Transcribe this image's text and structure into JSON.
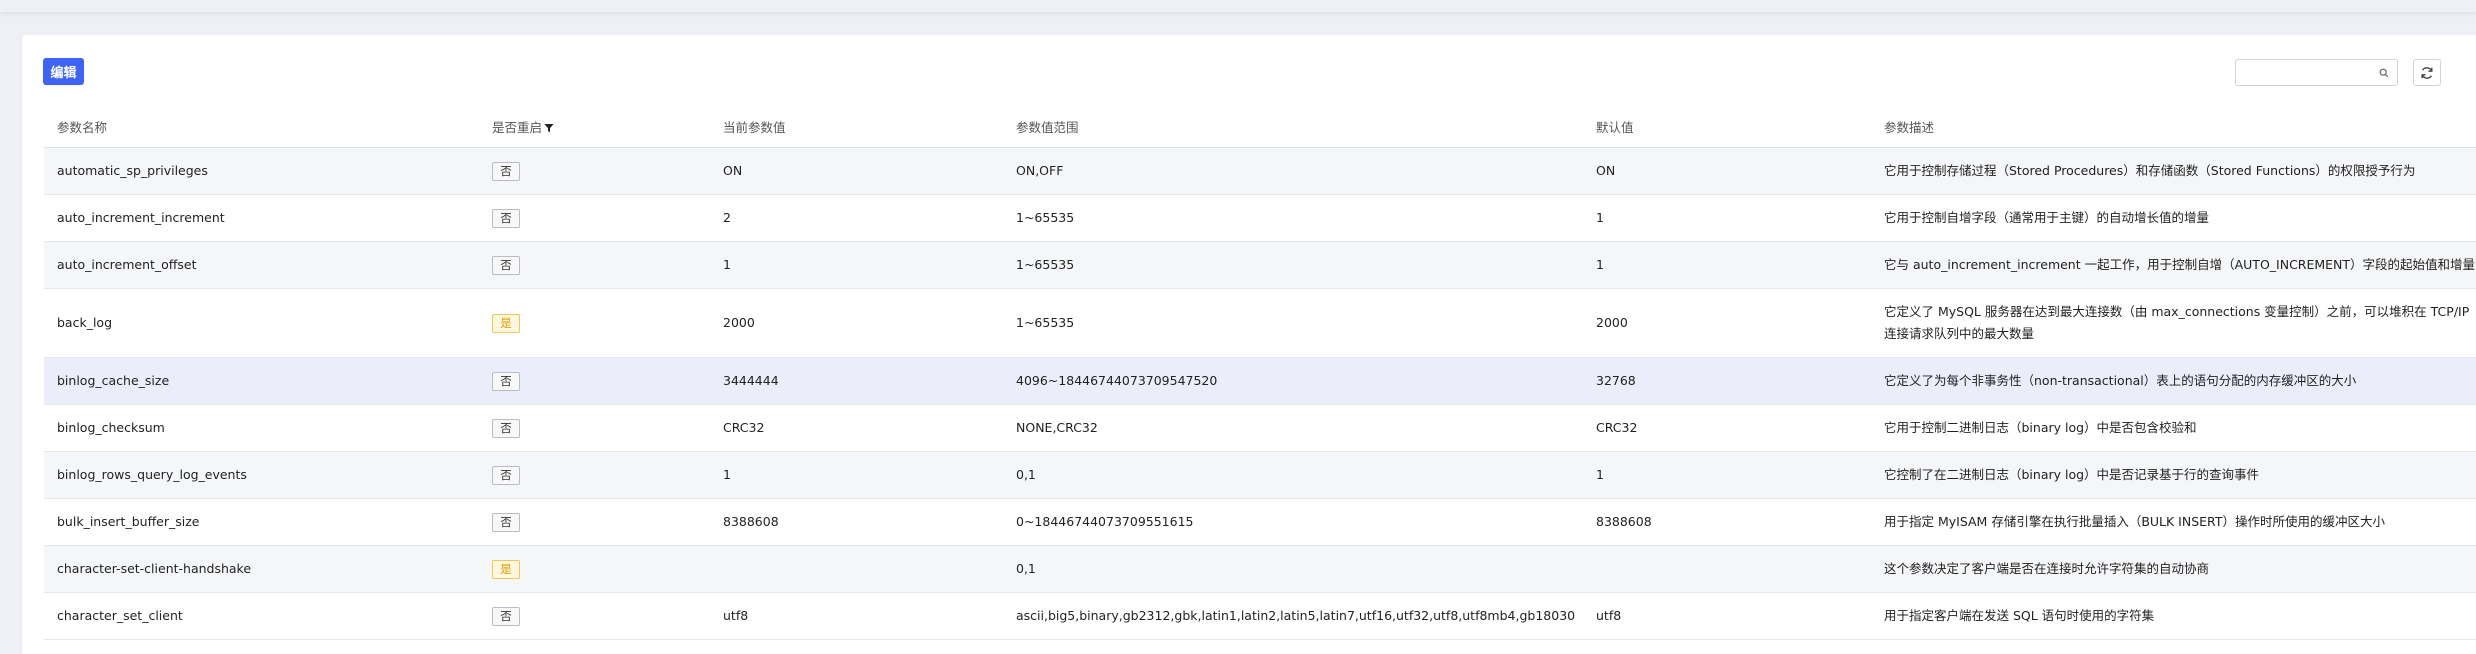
{
  "toolbar": {
    "edit_label": "编辑",
    "search_value": "",
    "search_placeholder": ""
  },
  "columns": [
    "参数名称",
    "是否重启",
    "当前参数值",
    "参数值范围",
    "默认值",
    "参数描述"
  ],
  "rows": [
    {
      "name": "automatic_sp_privileges",
      "restart": "否",
      "restart_flag": "no",
      "current": "ON",
      "range": "ON,OFF",
      "default": "ON",
      "desc": "它用于控制存储过程（Stored Procedures）和存储函数（Stored Functions）的权限授予行为"
    },
    {
      "name": "auto_increment_increment",
      "restart": "否",
      "restart_flag": "no",
      "current": "2",
      "range": "1~65535",
      "default": "1",
      "desc": "它用于控制自增字段（通常用于主键）的自动增长值的增量"
    },
    {
      "name": "auto_increment_offset",
      "restart": "否",
      "restart_flag": "no",
      "current": "1",
      "range": "1~65535",
      "default": "1",
      "desc": "它与 auto_increment_increment 一起工作，用于控制自增（AUTO_INCREMENT）字段的起始值和增量"
    },
    {
      "name": "back_log",
      "restart": "是",
      "restart_flag": "yes",
      "current": "2000",
      "range": "1~65535",
      "default": "2000",
      "desc": "它定义了 MySQL 服务器在达到最大连接数（由 max_connections 变量控制）之前，可以堆积在 TCP/IP 连接请求队列中的最大数量"
    },
    {
      "name": "binlog_cache_size",
      "restart": "否",
      "restart_flag": "no",
      "current": "3444444",
      "range": "4096~18446744073709547520",
      "default": "32768",
      "desc": "它定义了为每个非事务性（non-transactional）表上的语句分配的内存缓冲区的大小"
    },
    {
      "name": "binlog_checksum",
      "restart": "否",
      "restart_flag": "no",
      "current": "CRC32",
      "range": "NONE,CRC32",
      "default": "CRC32",
      "desc": "它用于控制二进制日志（binary log）中是否包含校验和"
    },
    {
      "name": "binlog_rows_query_log_events",
      "restart": "否",
      "restart_flag": "no",
      "current": "1",
      "range": "0,1",
      "default": "1",
      "desc": "它控制了在二进制日志（binary log）中是否记录基于行的查询事件"
    },
    {
      "name": "bulk_insert_buffer_size",
      "restart": "否",
      "restart_flag": "no",
      "current": "8388608",
      "range": "0~18446744073709551615",
      "default": "8388608",
      "desc": "用于指定 MyISAM 存储引擎在执行批量插入（BULK INSERT）操作时所使用的缓冲区大小"
    },
    {
      "name": "character-set-client-handshake",
      "restart": "是",
      "restart_flag": "yes",
      "current": "",
      "range": "0,1",
      "default": "",
      "desc": "这个参数决定了客户端是否在连接时允许字符集的自动协商"
    },
    {
      "name": "character_set_client",
      "restart": "否",
      "restart_flag": "no",
      "current": "utf8",
      "range": "ascii,big5,binary,gb2312,gbk,latin1,latin2,latin5,latin7,utf16,utf32,utf8,utf8mb4,gb18030",
      "default": "utf8",
      "desc": "用于指定客户端在发送 SQL 语句时使用的字符集"
    }
  ],
  "colors": {
    "primary": "#3d64f4",
    "badge_yes_border": "#f4c55a",
    "badge_yes_text": "#e09a00",
    "row_highlight": "#ebeefa"
  },
  "icons": {
    "search": "search-icon",
    "refresh": "refresh-icon",
    "filter": "filter-icon"
  }
}
